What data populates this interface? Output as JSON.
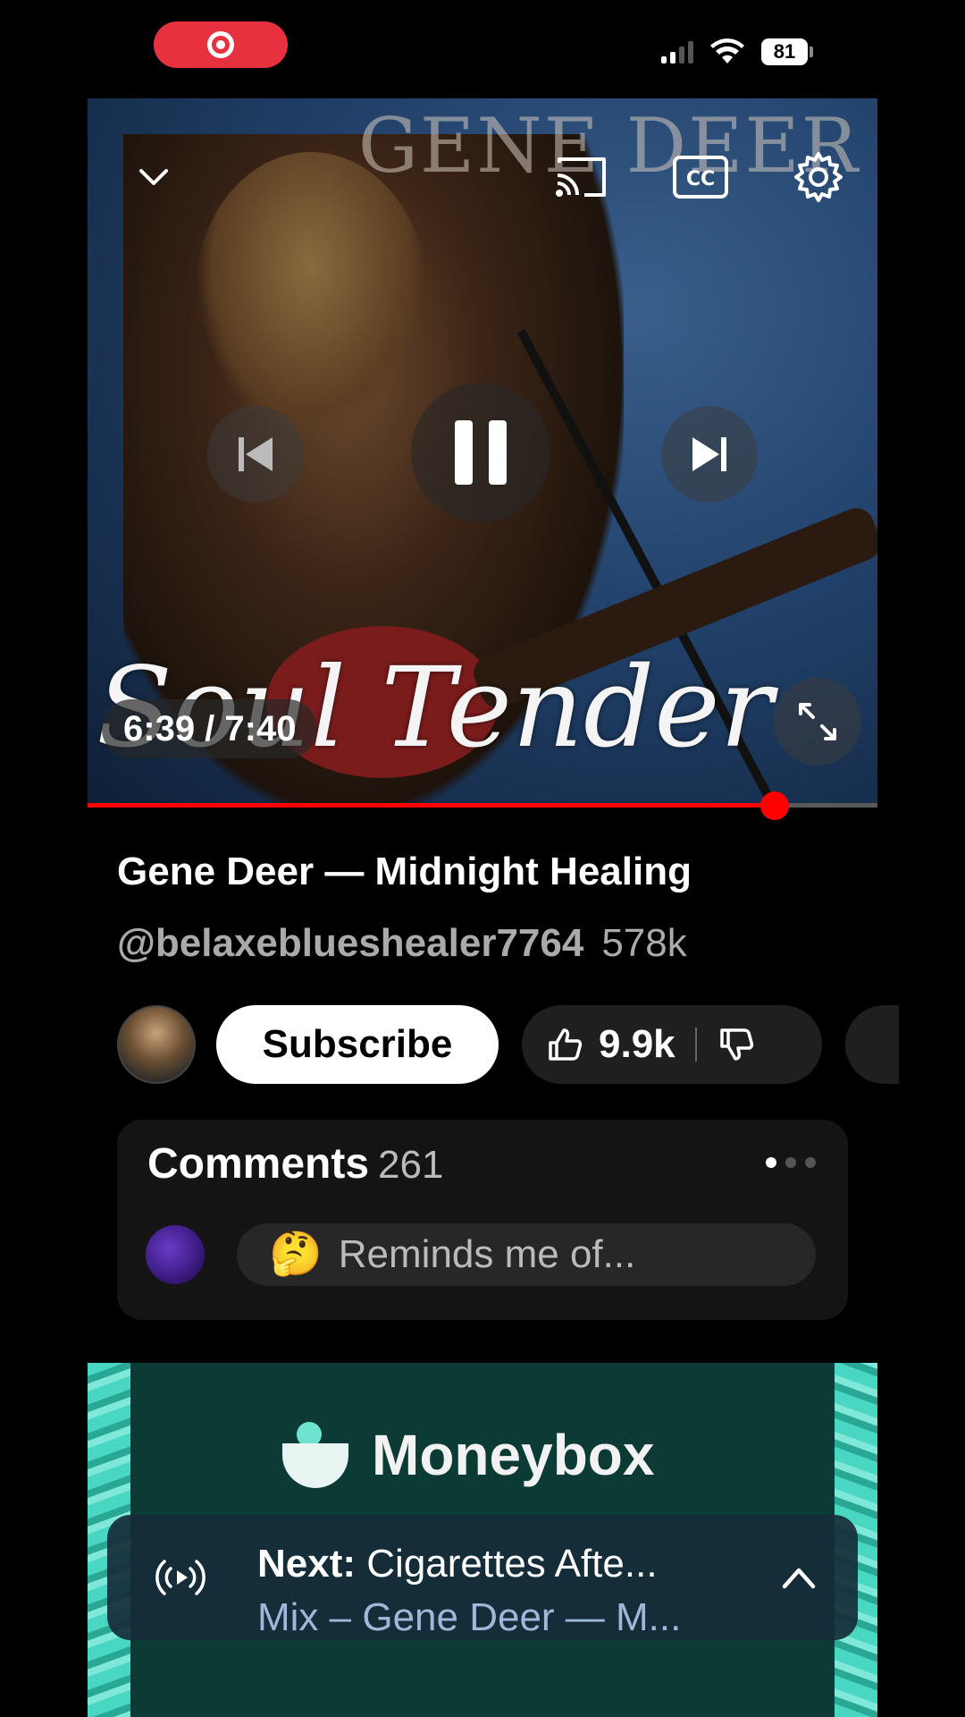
{
  "status_bar": {
    "battery": "81"
  },
  "player": {
    "watermark": "GENE DEER",
    "overlay_text": "Soul Tender",
    "time": "6:39 / 7:40",
    "progress": 0.87
  },
  "video": {
    "title": "Gene Deer — Midnight Healing",
    "channel": "@belaxeblueshealer7764",
    "subscribers": "578k",
    "subscribe_label": "Subscribe",
    "likes": "9.9k"
  },
  "comments": {
    "label": "Comments",
    "count": "261",
    "emoji": "🤔",
    "placeholder": "Reminds me of..."
  },
  "ad": {
    "brand": "Moneybox"
  },
  "up_next": {
    "prefix": "Next:",
    "title": "Cigarettes Afte...",
    "subtitle": "Mix – Gene Deer — M..."
  }
}
